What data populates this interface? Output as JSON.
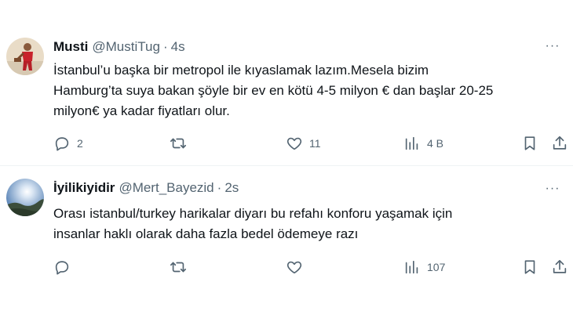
{
  "tweets": [
    {
      "display_name": "Musti",
      "handle": "@MustiTug",
      "separator": "·",
      "time": "4s",
      "more_glyph": "···",
      "lines": [
        "İstanbul’u başka bir metropol ile kıyaslamak lazım.Mesela bizim",
        "Hamburg’ta suya bakan şöyle bir ev en kötü 4-5 milyon € dan başlar 20-25",
        "milyon€ ya kadar fiyatları olur."
      ],
      "replies": "2",
      "retweets": "",
      "likes": "11",
      "views": "4 B"
    },
    {
      "display_name": "İyilikiyidir",
      "handle": "@Mert_Bayezid",
      "separator": "·",
      "time": "2s",
      "more_glyph": "···",
      "lines": [
        "Orası istanbul/turkey harikalar diyarı bu refahı konforu yaşamak için",
        "insanlar haklı olarak daha fazla  bedel ödemeye razı"
      ],
      "replies": "",
      "retweets": "",
      "likes": "",
      "views": "107"
    }
  ],
  "icons": {
    "reply": "reply-icon",
    "retweet": "retweet-icon",
    "like": "heart-icon",
    "views": "views-chart-icon",
    "bookmark": "bookmark-icon",
    "share": "share-icon",
    "more": "more-options-icon"
  },
  "colors": {
    "text_primary": "#0f1419",
    "text_secondary": "#536471",
    "divider": "#eff3f4"
  }
}
